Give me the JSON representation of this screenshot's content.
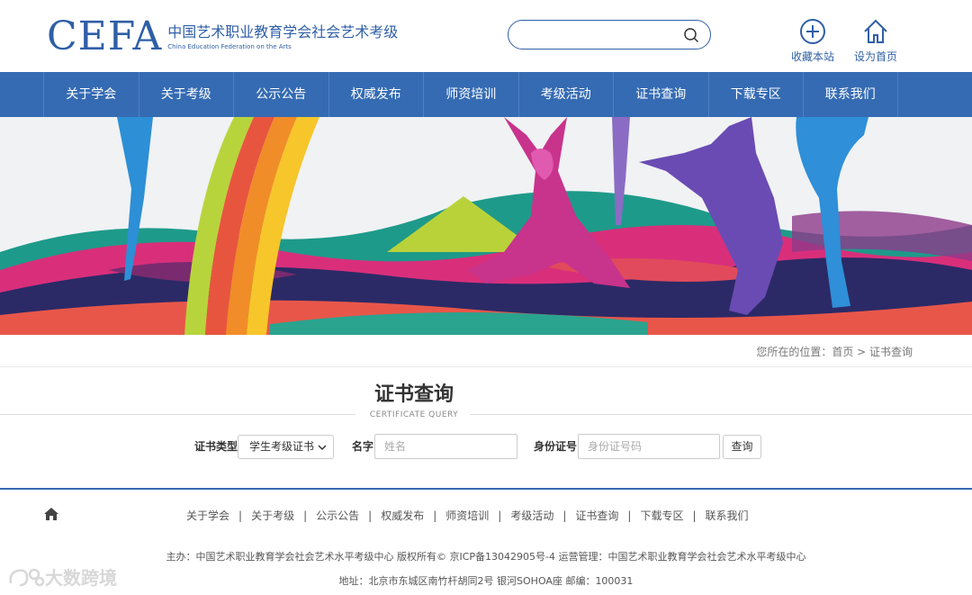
{
  "header": {
    "logo_mark": "CEFA",
    "logo_cn": "中国艺术职业教育学会社会艺术考级",
    "logo_en": "China Education Federation on the Arts",
    "search_placeholder": "",
    "favorite_label": "收藏本站",
    "homepage_label": "设为首页"
  },
  "nav": {
    "items": [
      "关于学会",
      "关于考级",
      "公示公告",
      "权威发布",
      "师资培训",
      "考级活动",
      "证书查询",
      "下载专区",
      "联系我们"
    ]
  },
  "breadcrumb": "您所在的位置：首页 > 证书查询",
  "section": {
    "title": "证书查询",
    "subtitle": "CERTIFICATE QUERY"
  },
  "form": {
    "type_label": "证书类型",
    "type_value": "学生考级证书",
    "name_label": "名字",
    "name_placeholder": "姓名",
    "id_label": "身份证号",
    "id_placeholder": "身份证号码",
    "submit_label": "查询"
  },
  "footer": {
    "links": [
      "关于学会",
      "关于考级",
      "公示公告",
      "权威发布",
      "师资培训",
      "考级活动",
      "证书查询",
      "下载专区",
      "联系我们"
    ],
    "separator": "|",
    "line1": "主办：中国艺术职业教育学会社会艺术水平考级中心 版权所有© 京ICP备13042905号-4 运营管理：中国艺术职业教育学会社会艺术水平考级中心",
    "line2": "地址：北京市东城区南竹杆胡同2号 银河SOHOA座 邮编：100031"
  },
  "watermark": "大数跨境",
  "colors": {
    "brand_blue": "#356bb3",
    "logo_blue": "#2f5fa7"
  }
}
